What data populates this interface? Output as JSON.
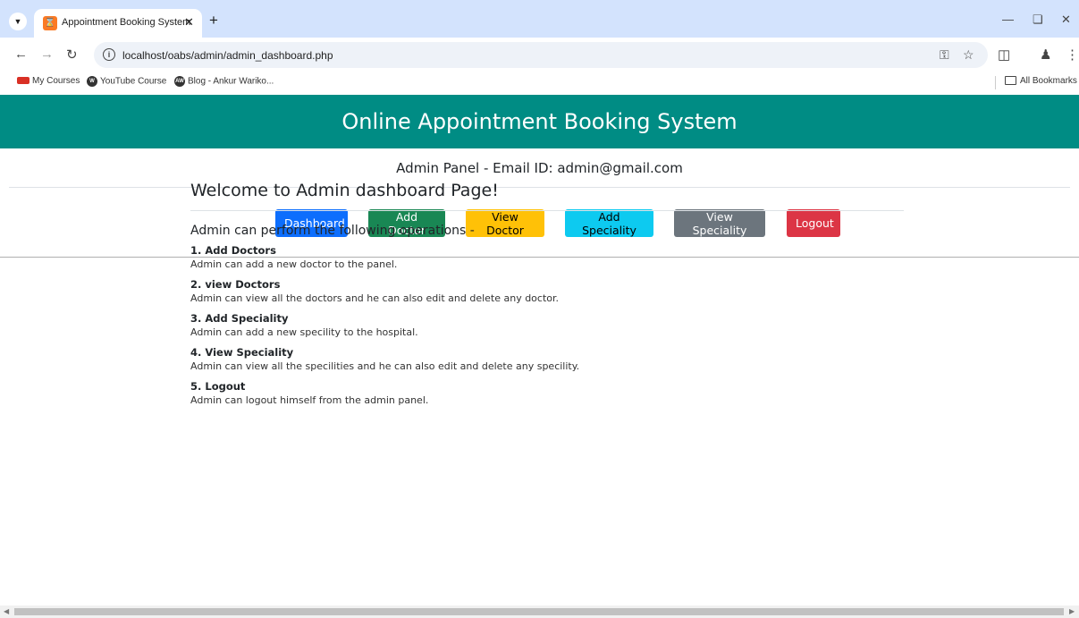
{
  "browser": {
    "tab_title": "Appointment Booking System",
    "url": "localhost/oabs/admin/admin_dashboard.php",
    "bookmarks": [
      {
        "label": "My Courses"
      },
      {
        "label": "YouTube Course"
      },
      {
        "label": "Blog - Ankur Wariko..."
      }
    ],
    "all_bookmarks_label": "All Bookmarks"
  },
  "page": {
    "header_title": "Online Appointment Booking System",
    "admin_panel_label": "Admin Panel - Email ID: admin@gmail.com",
    "nav": {
      "dashboard": "Dashboard",
      "add_doctor": "Add Doctor",
      "view_doctor": "View Doctor",
      "add_speciality": "Add Speciality",
      "view_speciality": "View Speciality",
      "logout": "Logout"
    },
    "welcome": "Welcome to Admin dashboard Page!",
    "ops_title": "Admin can perform the following operations -",
    "operations": [
      {
        "title": "1. Add Doctors",
        "desc": "Admin can add a new doctor to the panel."
      },
      {
        "title": "2. view Doctors",
        "desc": "Admin can view all the doctors and he can also edit and delete any doctor."
      },
      {
        "title": "3. Add Speciality",
        "desc": "Admin can add a new specility to the hospital."
      },
      {
        "title": "4. View Speciality",
        "desc": "Admin can view all the specilities and he can also edit and delete any specility."
      },
      {
        "title": "5. Logout",
        "desc": "Admin can logout himself from the admin panel."
      }
    ]
  },
  "colors": {
    "header_bg": "#008c84",
    "btn_primary": "#0d6efd",
    "btn_success": "#198754",
    "btn_warning": "#ffc107",
    "btn_info": "#0dcaf0",
    "btn_secondary": "#6c757d",
    "btn_danger": "#dc3545"
  }
}
